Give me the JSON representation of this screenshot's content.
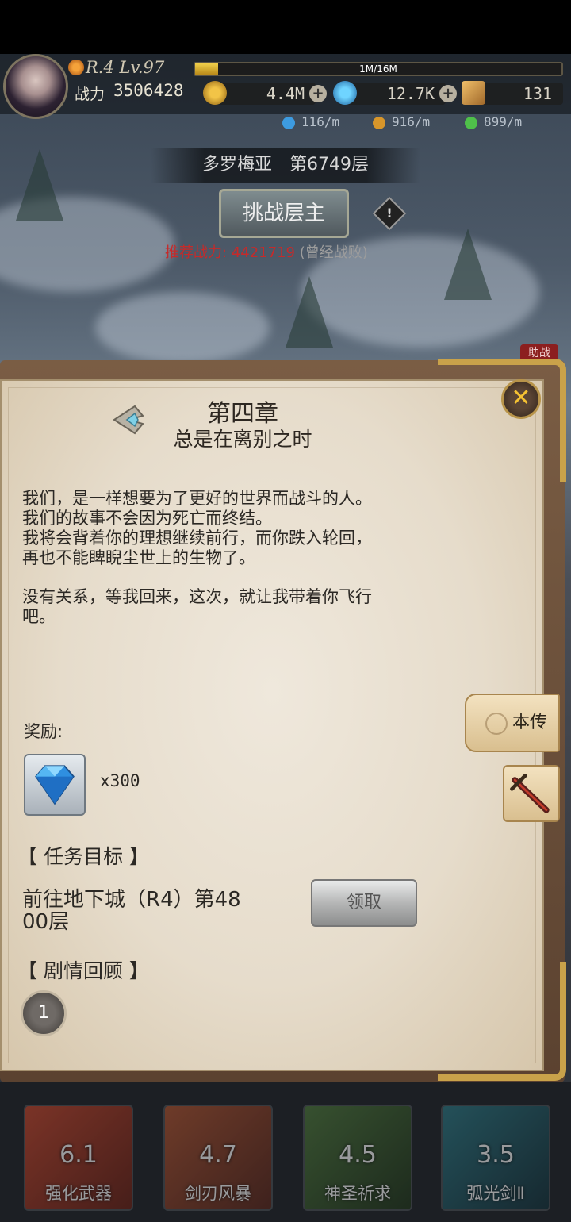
{
  "hud": {
    "rank_level": "R.4 Lv.97",
    "exp_text": "1M/16M",
    "exp_progress": 0.0625,
    "power_label": "战力",
    "power_value": "3506428",
    "resources": [
      {
        "icon": "gold-coin-icon",
        "value": "4.4M"
      },
      {
        "icon": "blue-gem-icon",
        "value": "12.7K"
      },
      {
        "icon": "scroll-ticket-icon",
        "value": "131"
      }
    ],
    "rates": [
      {
        "icon": "blue-orb-icon",
        "value": "116/m"
      },
      {
        "icon": "gold-coin-icon",
        "value": "916/m"
      },
      {
        "icon": "green-gem-icon",
        "value": "899/m"
      }
    ]
  },
  "floor": {
    "title": "多罗梅亚　第6749层",
    "challenge_label": "挑战层主",
    "recommended_label": "推荐战力:",
    "recommended_value": "4421719",
    "recommended_note": "(曾经战败)",
    "assist_label": "助战"
  },
  "book": {
    "chapter_title": "第四章",
    "chapter_subtitle": "总是在离别之时",
    "story_paragraphs": [
      "我们，是一样想要为了更好的世界而战斗的人。\n我们的故事不会因为死亡而终结。\n我将会背着你的理想继续前行，而你跌入轮回，\n再也不能睥睨尘世上的生物了。",
      "没有关系，等我回来，这次，就让我带着你飞行\n吧。"
    ],
    "reward_label": "奖励:",
    "reward_qty": "x300",
    "mission_header": "【 任务目标 】",
    "mission_text": "前往地下城（R4）第48\n00层",
    "claim_label": "领取",
    "review_header": "【 剧情回顾 】",
    "review_number": "1",
    "side_tab_bio": "本传"
  },
  "skills": [
    {
      "value": "6.1",
      "name": "强化武器",
      "color": "#c8452a"
    },
    {
      "value": "4.7",
      "name": "剑刃风暴",
      "color": "#b2532e"
    },
    {
      "value": "4.5",
      "name": "神圣祈求",
      "color": "#4e7a3a"
    },
    {
      "value": "3.5",
      "name": "弧光剑Ⅱ",
      "color": "#2b7a86"
    }
  ]
}
